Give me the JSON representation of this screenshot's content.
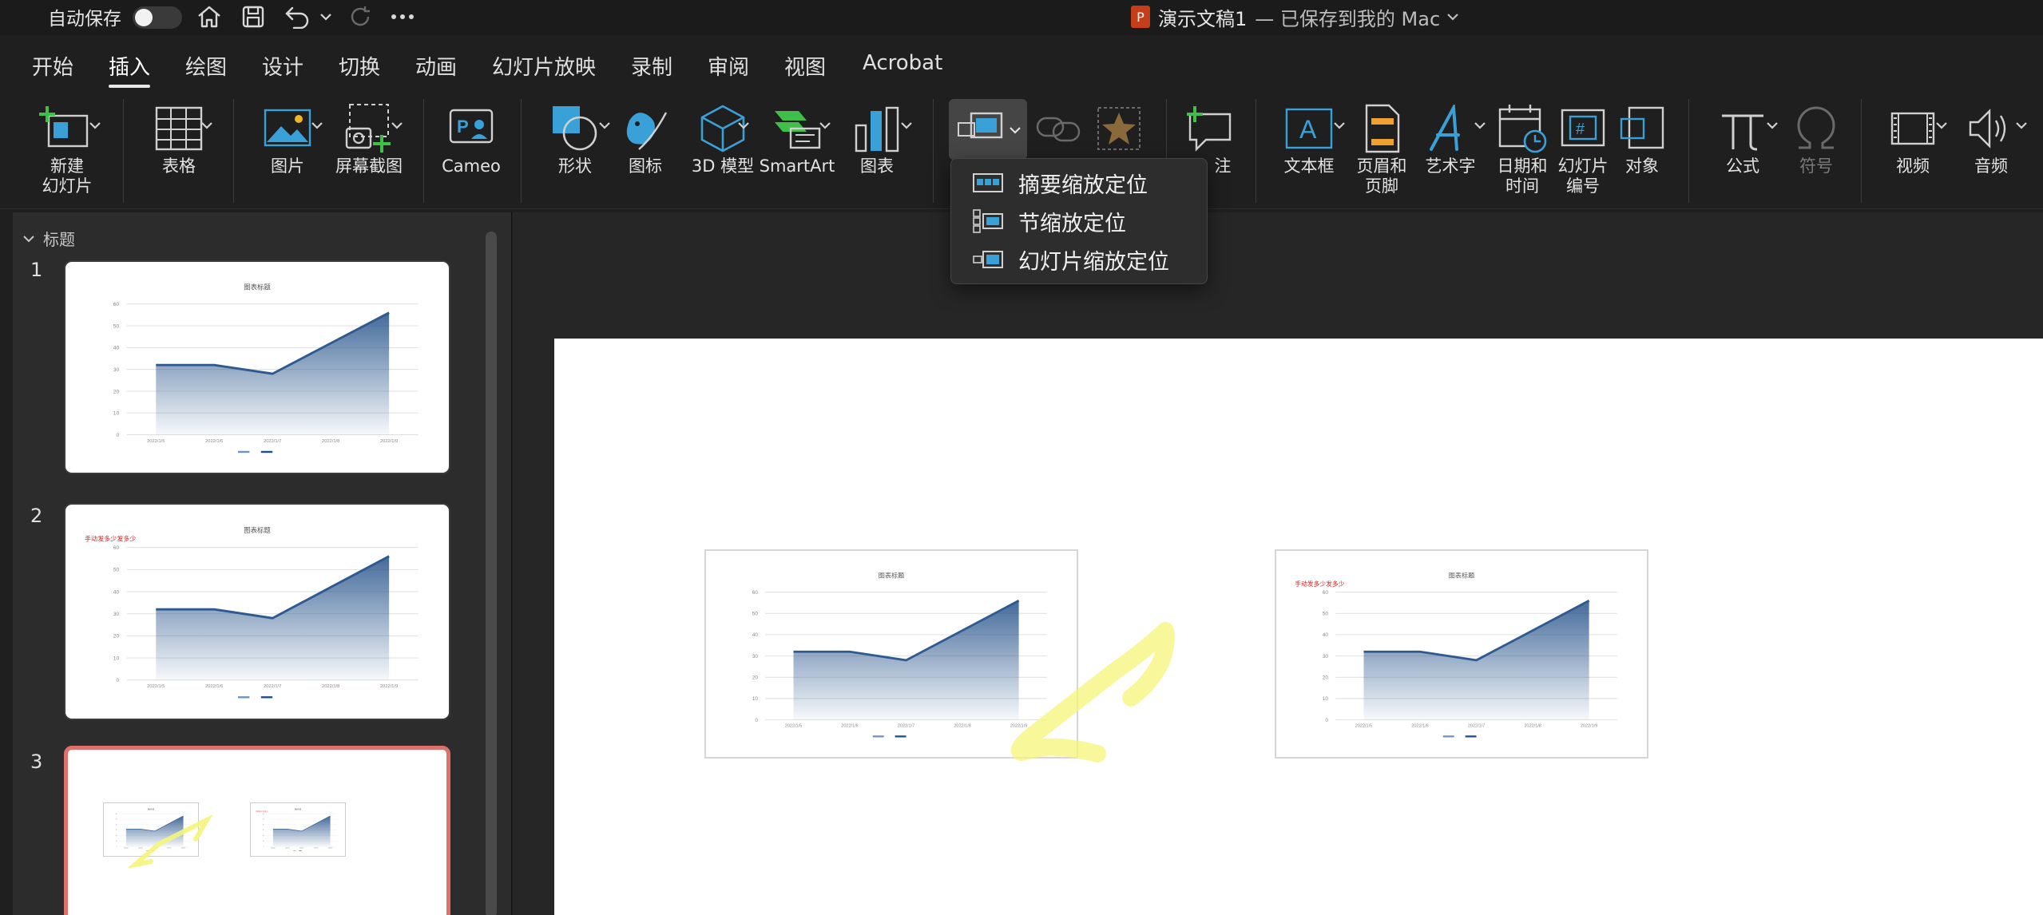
{
  "titlebar": {
    "autosave_label": "自动保存",
    "document_name": "演示文稿1",
    "save_status": "— 已保存到我的 Mac"
  },
  "tabs": [
    "开始",
    "插入",
    "绘图",
    "设计",
    "切换",
    "动画",
    "幻灯片放映",
    "录制",
    "审阅",
    "视图",
    "Acrobat"
  ],
  "active_tab": "插入",
  "ribbon": {
    "new_slide": "新建\n幻灯片",
    "table": "表格",
    "picture": "图片",
    "screenshot": "屏幕截图",
    "cameo": "Cameo",
    "shapes": "形状",
    "icons": "图标",
    "model3d": "3D 模型",
    "smartart": "SmartArt",
    "chart": "图表",
    "comment_partial": "注",
    "textbox": "文本框",
    "header_footer": "页眉和\n页脚",
    "wordart": "艺术字",
    "date_time": "日期和\n时间",
    "slide_number": "幻灯片\n编号",
    "object": "对象",
    "equation": "公式",
    "symbol": "符号",
    "video": "视频",
    "audio": "音频"
  },
  "zoom_menu": {
    "items": [
      "摘要缩放定位",
      "节缩放定位",
      "幻灯片缩放定位"
    ]
  },
  "sidebar": {
    "section_title": "标题",
    "slides": [
      {
        "number": "1",
        "chart_title": "图表标题",
        "annotation": ""
      },
      {
        "number": "2",
        "chart_title": "图表标题",
        "annotation": "手动发多少发多少"
      },
      {
        "number": "3",
        "chart_title": "图表标题",
        "annotation": "手动发多少发多少"
      }
    ]
  },
  "slide": {
    "left_chart_title": "图表标题",
    "right_chart_title": "图表标题",
    "right_annotation": "手动发多少发多少"
  },
  "colors": {
    "selected_border": "#e0716a",
    "chart_line": "#2f5a8f",
    "annotation_red": "#e02020",
    "highlighter": "#f5f57a"
  },
  "chart_data": {
    "type": "area",
    "title": "图表标题",
    "categories": [
      "2022/1/5",
      "2022/1/6",
      "2022/1/7",
      "2022/1/8",
      "2022/1/9"
    ],
    "series": [
      {
        "values": [
          32,
          32,
          28,
          42,
          56
        ]
      },
      {
        "values": [
          32,
          32,
          28,
          42,
          56
        ]
      }
    ],
    "ylim": [
      0,
      60
    ],
    "yticks": [
      0,
      10,
      20,
      30,
      40,
      50,
      60
    ],
    "grid": true,
    "legend": "bottom"
  }
}
